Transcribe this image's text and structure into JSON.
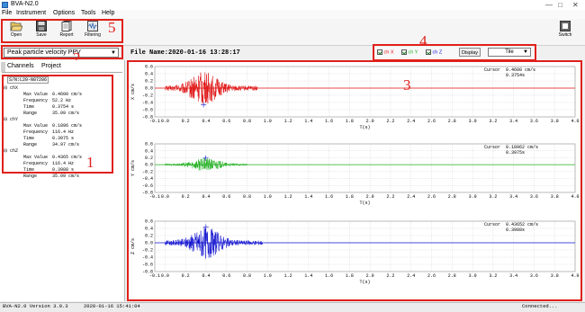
{
  "window": {
    "title": "BVA-N2.0",
    "minimize": "—",
    "maximize": "□",
    "close": "✕"
  },
  "menu": [
    "File",
    "Instrument",
    "Options",
    "Tools",
    "Help"
  ],
  "toolbar": {
    "buttons": [
      {
        "label": "Open",
        "icon": "folder-open-icon"
      },
      {
        "label": "Save",
        "icon": "floppy-disk-icon"
      },
      {
        "label": "Report",
        "icon": "report-document-icon"
      },
      {
        "label": "Filtering",
        "icon": "filter-waveform-icon"
      }
    ],
    "switch_label": "Switch"
  },
  "annotations": {
    "n1": "1",
    "n2": "2",
    "n3": "3",
    "n4": "4",
    "n5": "5"
  },
  "measure_select": {
    "value": "Peak particle velocity PPV"
  },
  "file_name": "File Name:2020-01-16 13:28:17",
  "channel_controls": {
    "channels": [
      {
        "label": "ch X",
        "color": "#e01010"
      },
      {
        "label": "ch Y",
        "color": "#20b020"
      },
      {
        "label": "ch Z",
        "color": "#1010d0"
      }
    ],
    "display_label": "Display",
    "layout_value": "Tile"
  },
  "tabs": [
    "Channels",
    "Project"
  ],
  "tree": {
    "device": "S/N:L20-N07206",
    "channels": [
      {
        "name": "chX",
        "max_label": "Max Value",
        "max_value": "0.4600 cm/s",
        "freq_label": "Frequency",
        "freq_value": "52.2 Hz",
        "time_label": "Time",
        "time_value": "0.3754 s",
        "range_label": "Range",
        "range_value": "35.09 cm/s"
      },
      {
        "name": "chY",
        "max_label": "Max Value",
        "max_value": "0.1896 cm/s",
        "freq_label": "Frequency",
        "freq_value": "116.4 Hz",
        "time_label": "Time",
        "time_value": "0.3975 s",
        "range_label": "Range",
        "range_value": "34.97 cm/s"
      },
      {
        "name": "chZ",
        "max_label": "Max Value",
        "max_value": "0.4365 cm/s",
        "freq_label": "Frequency",
        "freq_value": "116.4 Hz",
        "time_label": "Time",
        "time_value": "0.3988 s",
        "range_label": "Range",
        "range_value": "35.09 cm/s"
      }
    ]
  },
  "status": {
    "version": "BVA-N2.0 Version 3.0.3",
    "datetime": "2020-01-16 15:41:04",
    "connection": "Connected..."
  },
  "chart_data": [
    {
      "type": "line",
      "channel": "X",
      "color": "#e01010",
      "ylabel": "X cm/s",
      "xlabel": "T(s)",
      "cursor_label": "Cursor",
      "cursor_value": "0.4600 cm/s",
      "cursor_time": "0.3754s",
      "xlim": [
        -0.1,
        4.0
      ],
      "ylim": [
        -0.8,
        0.6
      ],
      "peak": {
        "x": 0.3754,
        "y": -0.46
      },
      "xticks": [
        "-0.1",
        "0.0",
        "0.2",
        "0.4",
        "0.6",
        "0.8",
        "1.0",
        "1.2",
        "1.4",
        "1.6",
        "1.8",
        "2.0",
        "2.2",
        "2.4",
        "2.6",
        "2.8",
        "3.0",
        "3.2",
        "3.4",
        "3.6",
        "3.8",
        "4.0"
      ],
      "yticks": [
        "0.6",
        "0.4",
        "0.2",
        "0.0",
        "-0.2",
        "-0.4",
        "-0.6",
        "-0.8"
      ],
      "signal": {
        "start": 0.0,
        "end": 0.9,
        "peak_time": 0.38,
        "amp": 0.46
      }
    },
    {
      "type": "line",
      "channel": "Y",
      "color": "#20b020",
      "ylabel": "Y cm/s",
      "xlabel": "T(s)",
      "cursor_label": "Cursor",
      "cursor_value": "0.18962 cm/s",
      "cursor_time": "0.3975s",
      "xlim": [
        -0.1,
        4.0
      ],
      "ylim": [
        -0.8,
        0.6
      ],
      "peak": {
        "x": 0.3975,
        "y": 0.19
      },
      "xticks": [
        "-0.1",
        "0.0",
        "0.2",
        "0.4",
        "0.6",
        "0.8",
        "1.0",
        "1.2",
        "1.4",
        "1.6",
        "1.8",
        "2.0",
        "2.2",
        "2.4",
        "2.6",
        "2.8",
        "3.0",
        "3.2",
        "3.4",
        "3.6",
        "3.8",
        "4.0"
      ],
      "yticks": [
        "0.6",
        "0.4",
        "0.2",
        "0.0",
        "-0.2",
        "-0.4",
        "-0.6",
        "-0.8"
      ],
      "signal": {
        "start": 0.0,
        "end": 0.8,
        "peak_time": 0.4,
        "amp": 0.19
      }
    },
    {
      "type": "line",
      "channel": "Z",
      "color": "#1010d0",
      "ylabel": "Z cm/s",
      "xlabel": "T(s)",
      "cursor_label": "Cursor",
      "cursor_value": "0.43652 cm/s",
      "cursor_time": "0.3988s",
      "xlim": [
        -0.1,
        4.0
      ],
      "ylim": [
        -0.8,
        0.6
      ],
      "peak": {
        "x": 0.3988,
        "y": 0.44
      },
      "xticks": [
        "-0.1",
        "0.0",
        "0.2",
        "0.4",
        "0.6",
        "0.8",
        "1.0",
        "1.2",
        "1.4",
        "1.6",
        "1.8",
        "2.0",
        "2.2",
        "2.4",
        "2.6",
        "2.8",
        "3.0",
        "3.2",
        "3.4",
        "3.6",
        "3.8",
        "4.0"
      ],
      "yticks": [
        "0.6",
        "0.4",
        "0.2",
        "0.0",
        "-0.2",
        "-0.4",
        "-0.6",
        "-0.8"
      ],
      "signal": {
        "start": 0.0,
        "end": 0.95,
        "peak_time": 0.4,
        "amp": 0.44
      }
    }
  ]
}
